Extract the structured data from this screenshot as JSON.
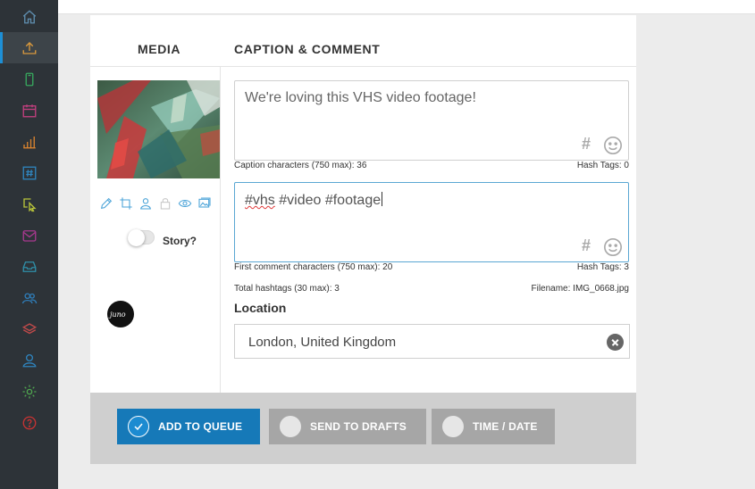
{
  "sidebar": {
    "items": [
      {
        "icon": "home-icon",
        "color": "#5f8fb0"
      },
      {
        "icon": "upload-icon",
        "color": "#d9993d",
        "active": true
      },
      {
        "icon": "phone-icon",
        "color": "#38a85e"
      },
      {
        "icon": "calendar-icon",
        "color": "#c23f7e"
      },
      {
        "icon": "analytics-icon",
        "color": "#d8832f"
      },
      {
        "icon": "hashtag-icon",
        "color": "#2f84bd"
      },
      {
        "icon": "cursor-select-icon",
        "color": "#b8c43a"
      },
      {
        "icon": "mail-icon",
        "color": "#a8398f"
      },
      {
        "icon": "inbox-icon",
        "color": "#2f8fa8"
      },
      {
        "icon": "users-icon",
        "color": "#2f7db8"
      },
      {
        "icon": "layers-icon",
        "color": "#c04a4a"
      },
      {
        "icon": "user-icon",
        "color": "#2f84bd"
      },
      {
        "icon": "settings-icon",
        "color": "#4fa64f"
      },
      {
        "icon": "help-icon",
        "color": "#c63333"
      }
    ]
  },
  "headers": {
    "media": "MEDIA",
    "caption": "CAPTION & COMMENT"
  },
  "media": {
    "story_label": "Story?",
    "story_enabled": false,
    "account_avatar_text": "juno"
  },
  "caption": {
    "text": "We're loving this VHS video footage!",
    "chars_label": "Caption characters (750 max): 36",
    "hashtags_label": "Hash Tags: 0"
  },
  "comment": {
    "tag1": "#vhs",
    "tag_rest": " #video #footage",
    "chars_label": "First comment characters (750 max): 20",
    "hashtags_label": "Hash Tags: 3"
  },
  "totals": {
    "total_hashtags": "Total hashtags (30 max): 3",
    "filename": "Filename: IMG_0668.jpg"
  },
  "location": {
    "label": "Location",
    "value": "London, United Kingdom"
  },
  "actions": {
    "add_to_queue": "ADD TO QUEUE",
    "send_to_drafts": "SEND TO DRAFTS",
    "time_date": "TIME / DATE"
  },
  "colors": {
    "accent": "#1679b8",
    "sidebar_bg": "#2d3338",
    "button_gray": "#a6a6a6"
  }
}
